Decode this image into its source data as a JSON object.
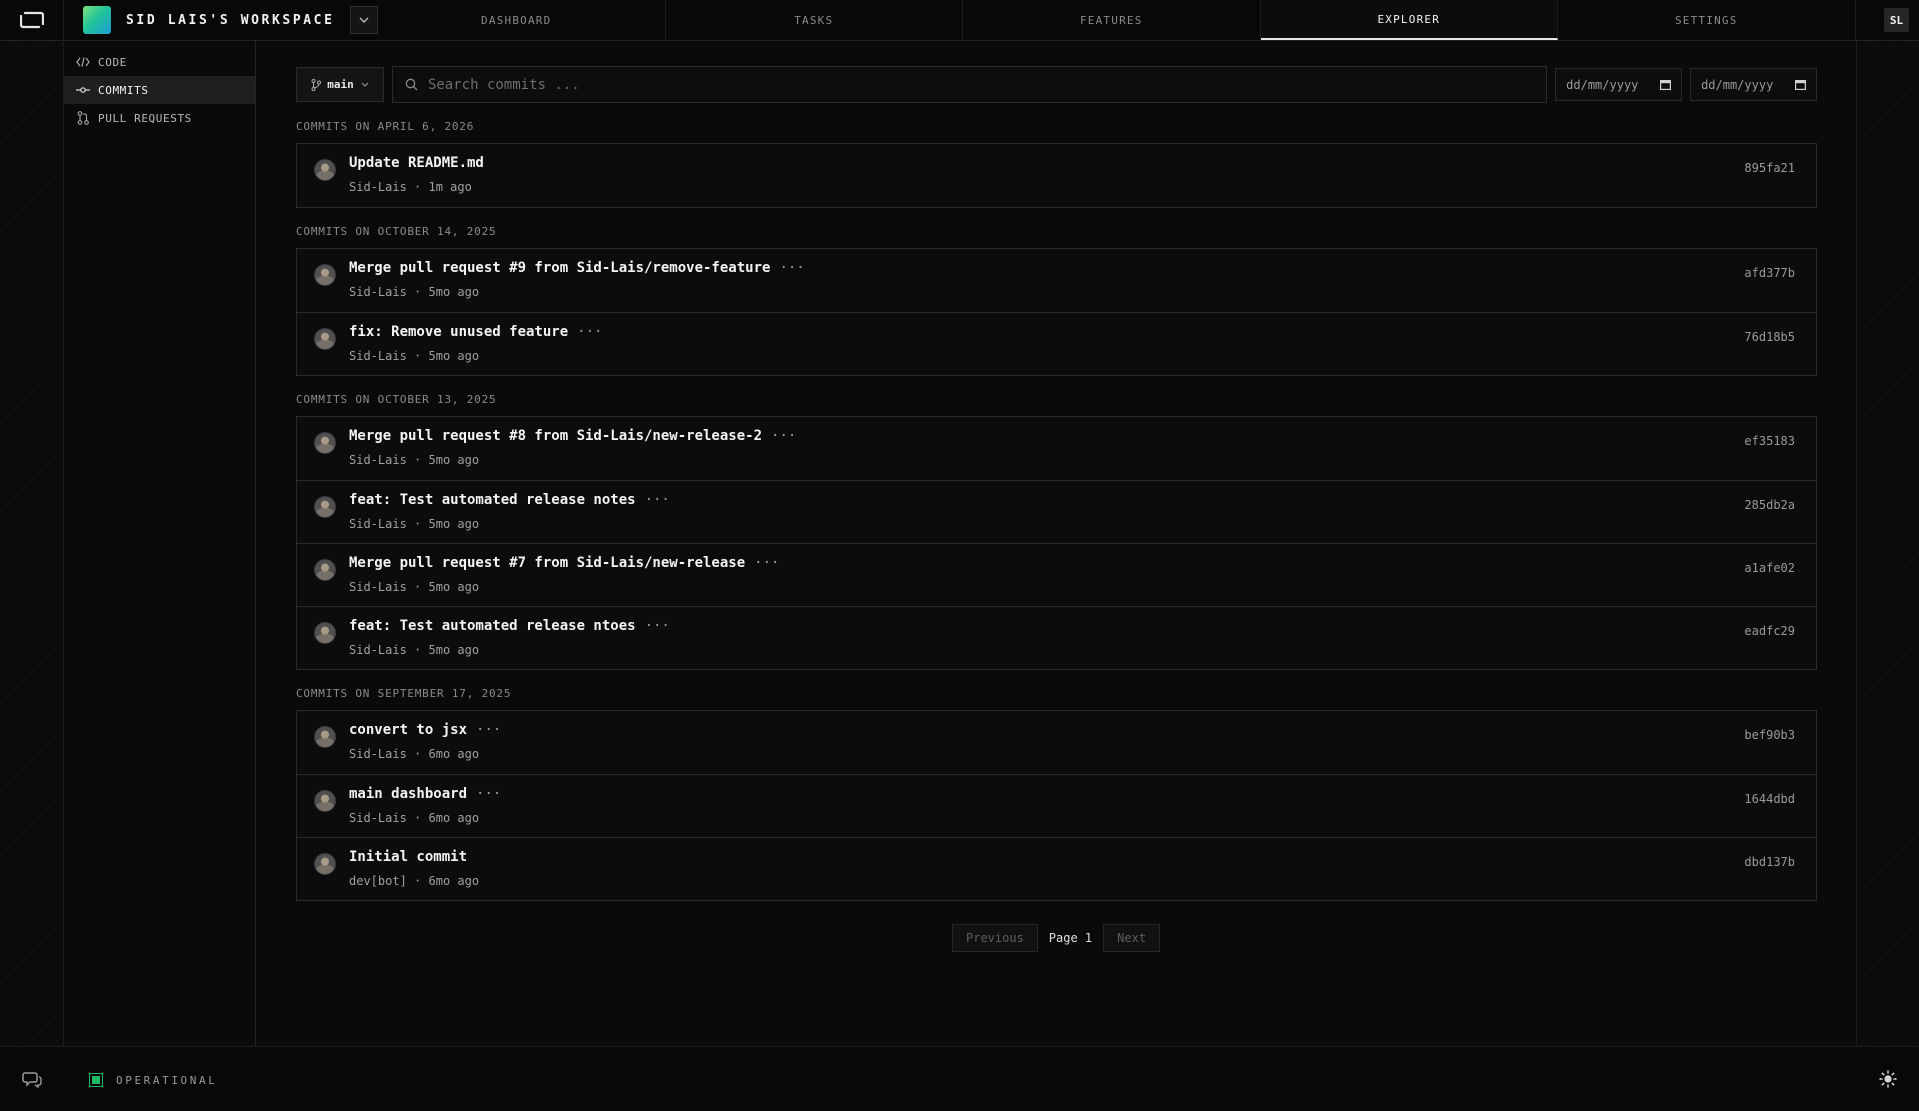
{
  "header": {
    "workspace_name": "SID LAIS'S WORKSPACE",
    "tabs": [
      {
        "label": "DASHBOARD"
      },
      {
        "label": "TASKS"
      },
      {
        "label": "FEATURES"
      },
      {
        "label": "EXPLORER"
      },
      {
        "label": "SETTINGS"
      }
    ],
    "active_tab": "EXPLORER",
    "user_initials": "SL"
  },
  "sidebar": {
    "items": [
      {
        "label": "CODE",
        "icon": "code-icon"
      },
      {
        "label": "COMMITS",
        "icon": "commit-icon"
      },
      {
        "label": "PULL REQUESTS",
        "icon": "pull-request-icon"
      }
    ],
    "active": "COMMITS"
  },
  "toolbar": {
    "branch": "main",
    "search_placeholder": "Search commits ...",
    "date_from_placeholder": "dd/mm/yyyy",
    "date_to_placeholder": "dd/mm/yyyy"
  },
  "groups": [
    {
      "heading": "COMMITS ON APRIL 6, 2026",
      "commits": [
        {
          "message": "Update README.md",
          "author": "Sid-Lais",
          "time": "1m ago",
          "sha": "895fa21",
          "more": false
        }
      ]
    },
    {
      "heading": "COMMITS ON OCTOBER 14, 2025",
      "commits": [
        {
          "message": "Merge pull request #9 from Sid-Lais/remove-feature",
          "author": "Sid-Lais",
          "time": "5mo ago",
          "sha": "afd377b",
          "more": true
        },
        {
          "message": "fix: Remove unused feature",
          "author": "Sid-Lais",
          "time": "5mo ago",
          "sha": "76d18b5",
          "more": true
        }
      ]
    },
    {
      "heading": "COMMITS ON OCTOBER 13, 2025",
      "commits": [
        {
          "message": "Merge pull request #8 from Sid-Lais/new-release-2",
          "author": "Sid-Lais",
          "time": "5mo ago",
          "sha": "ef35183",
          "more": true
        },
        {
          "message": "feat: Test automated release notes",
          "author": "Sid-Lais",
          "time": "5mo ago",
          "sha": "285db2a",
          "more": true
        },
        {
          "message": "Merge pull request #7 from Sid-Lais/new-release",
          "author": "Sid-Lais",
          "time": "5mo ago",
          "sha": "a1afe02",
          "more": true
        },
        {
          "message": "feat: Test automated release ntoes",
          "author": "Sid-Lais",
          "time": "5mo ago",
          "sha": "eadfc29",
          "more": true
        }
      ]
    },
    {
      "heading": "COMMITS ON SEPTEMBER 17, 2025",
      "commits": [
        {
          "message": "convert to jsx",
          "author": "Sid-Lais",
          "time": "6mo ago",
          "sha": "bef90b3",
          "more": true
        },
        {
          "message": "main dashboard",
          "author": "Sid-Lais",
          "time": "6mo ago",
          "sha": "1644dbd",
          "more": true
        },
        {
          "message": "Initial commit",
          "author": "dev[bot]",
          "time": "6mo ago",
          "sha": "dbd137b",
          "more": false
        }
      ]
    }
  ],
  "pagination": {
    "previous": "Previous",
    "page_label": "Page 1",
    "next": "Next"
  },
  "status": {
    "text": "OPERATIONAL",
    "color": "#1fb86a"
  },
  "meta_separator": "·",
  "more_glyph": "···"
}
